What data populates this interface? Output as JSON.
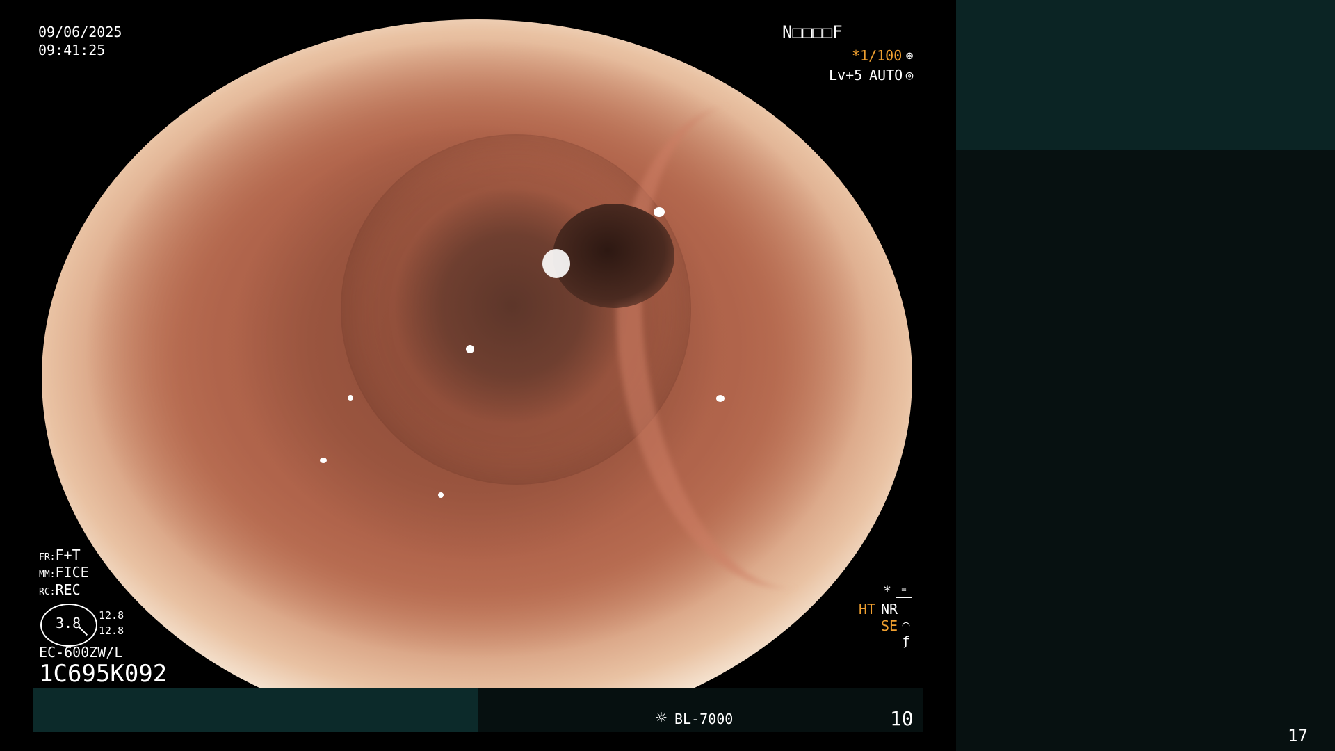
{
  "overlay": {
    "date": "09/06/2025",
    "time": "09:41:25",
    "patient_id": "N□□□□F",
    "shutter": "*1/100",
    "level": "Lv+5",
    "auto": "AUTO",
    "fr_label": "FR:",
    "fr_value": "F+T",
    "mm_label": "MM:",
    "mm_value": "FICE",
    "rc_label": "RC:",
    "rc_value": "REC",
    "zoom_value": "3.8",
    "zoom_a": "12.8",
    "zoom_b": "12.8",
    "scope_model": "EC-600ZW/L",
    "serial": "1C695K092",
    "ht": "HT",
    "nr": "NR",
    "se": "SE",
    "star": "*",
    "light_source": "BL-7000",
    "counter": "10",
    "page_number": "17"
  },
  "colors": {
    "text_orange": "#f0a030",
    "panel_top": "#0b2424",
    "panel_bottom": "#071111"
  },
  "icons": [
    "shutter-icon",
    "auto-iris-icon",
    "settings-icon",
    "enhance-icon",
    "filter-icon",
    "sun-icon"
  ]
}
